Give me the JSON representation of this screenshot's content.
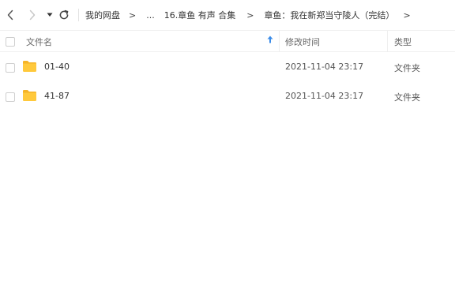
{
  "breadcrumb": {
    "items": [
      "我的网盘",
      "...",
      "16.章鱼 有声 合集",
      "章鱼：我在新郑当守陵人（完结）"
    ],
    "separator": ">"
  },
  "table": {
    "headers": {
      "name": "文件名",
      "modified": "修改时间",
      "type": "类型"
    },
    "rows": [
      {
        "name": "01-40",
        "modified": "2021-11-04 23:17",
        "type": "文件夹",
        "icon": "folder-icon"
      },
      {
        "name": "41-87",
        "modified": "2021-11-04 23:17",
        "type": "文件夹",
        "icon": "folder-icon"
      }
    ]
  },
  "colors": {
    "folder": "#FFC93C",
    "folder_tab": "#F5B428",
    "sort_arrow": "#3B8CE8"
  }
}
